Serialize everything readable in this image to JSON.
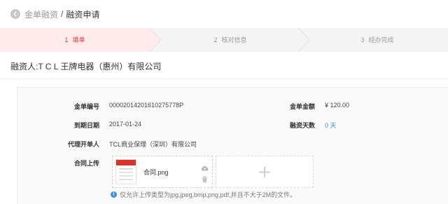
{
  "breadcrumb": {
    "first": "金单融资",
    "separator": "/",
    "current": "融资申请"
  },
  "steps": [
    {
      "num": "1",
      "label": "填单",
      "active": true
    },
    {
      "num": "2",
      "label": "核对信息",
      "active": false
    },
    {
      "num": "3",
      "label": "经办完成",
      "active": false
    }
  ],
  "colors": {
    "accent": "#e4393c",
    "link": "#3a8ee6"
  },
  "applicant": "融资人:T C L 王牌电器（惠州）有限公司",
  "fields": {
    "bill_no_label": "金单编号",
    "bill_no_value": "00002014201610275778P",
    "amount_label": "金单金额",
    "amount_value": "¥ 120.00",
    "due_date_label": "到期日期",
    "due_date_value": "2017-01-24",
    "days_label": "融资天数",
    "days_value": "0 天",
    "agent_label": "代理开单人",
    "agent_value": "TCL商业保理（深圳）有限公司",
    "contract_label": "合同上传"
  },
  "upload": {
    "file_name": "合同.png",
    "add_symbol": "+",
    "icons": [
      "back-icon",
      "cloud-icon",
      "trash-icon",
      "info-icon"
    ],
    "hint": "仅允许上传类型为jpg,jpeg,bmp,png,pdf,并且不大于2M的文件。"
  }
}
